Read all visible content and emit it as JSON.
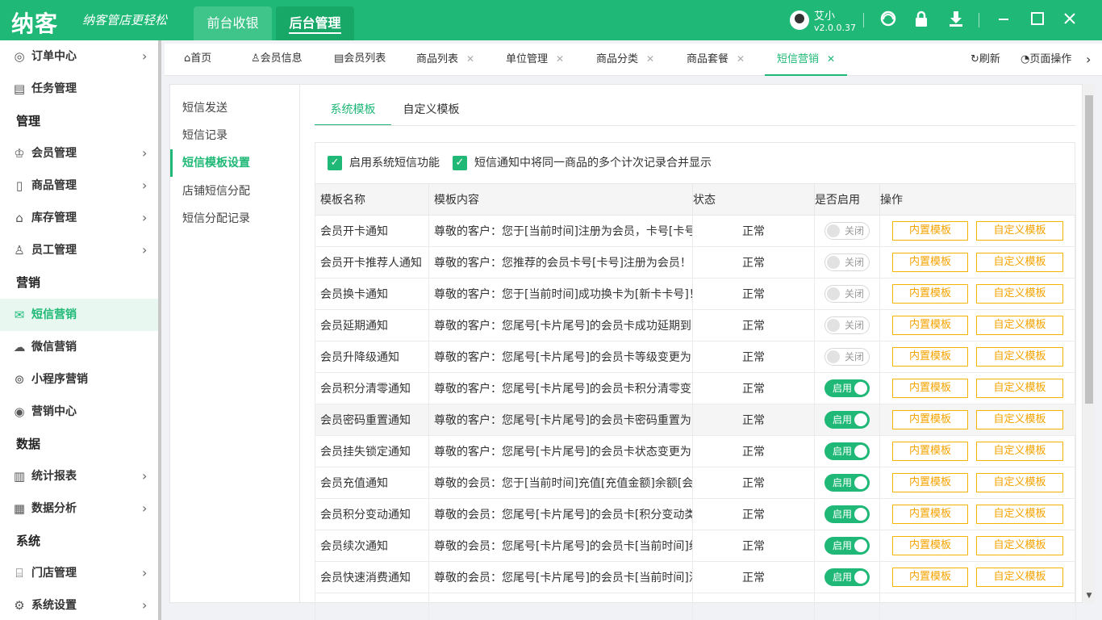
{
  "header": {
    "logo": "纳客",
    "slogan": "纳客管店更轻松",
    "top_tabs": [
      "前台收银",
      "后台管理"
    ],
    "user_name": "艾小",
    "version": "v2.0.0.37"
  },
  "sidebar": {
    "items": [
      {
        "label": "订单中心",
        "icon": "globe-icon"
      },
      {
        "label": "任务管理",
        "icon": "task-icon"
      },
      {
        "label": "会员管理",
        "icon": "crown-icon"
      },
      {
        "label": "商品管理",
        "icon": "product-icon"
      },
      {
        "label": "库存管理",
        "icon": "warehouse-icon"
      },
      {
        "label": "员工管理",
        "icon": "user-icon"
      },
      {
        "label": "短信营销",
        "icon": "mail-icon"
      },
      {
        "label": "微信营销",
        "icon": "wechat-icon"
      },
      {
        "label": "小程序营销",
        "icon": "miniprogram-icon"
      },
      {
        "label": "营销中心",
        "icon": "target-icon"
      },
      {
        "label": "统计报表",
        "icon": "bar-chart-icon"
      },
      {
        "label": "数据分析",
        "icon": "analysis-icon"
      },
      {
        "label": "门店管理",
        "icon": "store-icon"
      },
      {
        "label": "系统设置",
        "icon": "gear-icon"
      }
    ],
    "groups": [
      "管理",
      "营销",
      "数据",
      "系统"
    ]
  },
  "tabs": [
    {
      "label": "首页"
    },
    {
      "label": "会员信息"
    },
    {
      "label": "会员列表"
    },
    {
      "label": "商品列表"
    },
    {
      "label": "单位管理"
    },
    {
      "label": "商品分类"
    },
    {
      "label": "商品套餐"
    },
    {
      "label": "短信营销"
    }
  ],
  "tabbar_right": {
    "refresh": "刷新",
    "page_ops": "页面操作"
  },
  "subnav": [
    "短信发送",
    "短信记录",
    "短信模板设置",
    "店铺短信分配",
    "短信分配记录"
  ],
  "content_tabs": [
    "系统模板",
    "自定义模板"
  ],
  "options": [
    "启用系统短信功能",
    "短信通知中将同一商品的多个计次记录合并显示"
  ],
  "table": {
    "headers": [
      "模板名称",
      "模板内容",
      "状态",
      "是否启用",
      "操作"
    ],
    "toggle_on": "启用",
    "toggle_off": "关闭",
    "btn_builtin": "内置模板",
    "btn_custom": "自定义模板",
    "rows": [
      {
        "name": "会员开卡通知",
        "content": "尊敬的客户：您于[当前时间]注册为会员，卡号[卡号",
        "status": "正常",
        "enabled": false
      },
      {
        "name": "会员开卡推荐人通知",
        "content": "尊敬的客户：您推荐的会员卡号[卡号]注册为会员！",
        "status": "正常",
        "enabled": false
      },
      {
        "name": "会员换卡通知",
        "content": "尊敬的客户：您于[当前时间]成功换卡为[新卡卡号]！",
        "status": "正常",
        "enabled": false
      },
      {
        "name": "会员延期通知",
        "content": "尊敬的客户：您尾号[卡片尾号]的会员卡成功延期到[",
        "status": "正常",
        "enabled": false
      },
      {
        "name": "会员升降级通知",
        "content": "尊敬的客户：您尾号[卡片尾号]的会员卡等级变更为[",
        "status": "正常",
        "enabled": false
      },
      {
        "name": "会员积分清零通知",
        "content": "尊敬的客户：您尾号[卡片尾号]的会员卡积分清零变更",
        "status": "正常",
        "enabled": true
      },
      {
        "name": "会员密码重置通知",
        "content": "尊敬的客户：您尾号[卡片尾号]的会员卡密码重置为[",
        "status": "正常",
        "enabled": true
      },
      {
        "name": "会员挂失锁定通知",
        "content": "尊敬的客户：您尾号[卡片尾号]的会员卡状态变更为[",
        "status": "正常",
        "enabled": true
      },
      {
        "name": "会员充值通知",
        "content": "尊敬的会员：您于[当前时间]充值[充值金额]余额[会员",
        "status": "正常",
        "enabled": true
      },
      {
        "name": "会员积分变动通知",
        "content": "尊敬的会员：您尾号[卡片尾号]的会员卡[积分变动类",
        "status": "正常",
        "enabled": true
      },
      {
        "name": "会员续次通知",
        "content": "尊敬的会员：您尾号[卡片尾号]的会员卡[当前时间]续",
        "status": "正常",
        "enabled": true
      },
      {
        "name": "会员快速消费通知",
        "content": "尊敬的会员：您尾号[卡片尾号]的会员卡[当前时间]消",
        "status": "正常",
        "enabled": true
      },
      {
        "name": "",
        "content": "",
        "status": "",
        "enabled": null
      }
    ]
  },
  "colors": {
    "brand": "#1fb876",
    "warning": "#f5a300"
  }
}
